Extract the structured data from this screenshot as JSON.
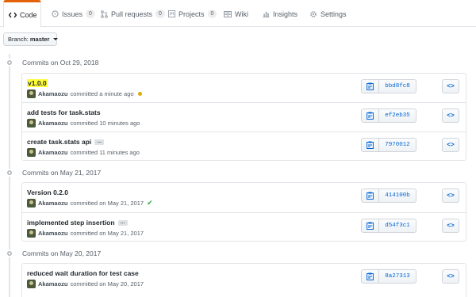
{
  "tabs": [
    {
      "label": "Code",
      "icon": "code-icon",
      "active": true
    },
    {
      "label": "Issues",
      "icon": "issue-icon",
      "count": "0"
    },
    {
      "label": "Pull requests",
      "icon": "pull-request-icon",
      "count": "0"
    },
    {
      "label": "Projects",
      "icon": "project-icon",
      "count": "0"
    },
    {
      "label": "Wiki",
      "icon": "book-icon"
    },
    {
      "label": "Insights",
      "icon": "graph-icon"
    },
    {
      "label": "Settings",
      "icon": "gear-icon"
    }
  ],
  "branch": {
    "prefix": "Branch:",
    "name": "master"
  },
  "groups": [
    {
      "heading": "Commits on Oct 29, 2018",
      "commits": [
        {
          "title": "v1.0.0",
          "highlight": true,
          "author": "Akamaozu",
          "time": "committed a minute ago",
          "status": "pending",
          "sha": "bbd8fc8"
        },
        {
          "title": "add tests for task.stats",
          "author": "Akamaozu",
          "time": "committed 10 minutes ago",
          "sha": "ef2eb35"
        },
        {
          "title": "create task.stats api",
          "expander": "…",
          "author": "Akamaozu",
          "time": "committed 11 minutes ago",
          "sha": "7970012"
        }
      ]
    },
    {
      "heading": "Commits on May 21, 2017",
      "commits": [
        {
          "title": "Version 0.2.0",
          "author": "Akamaozu",
          "time": "committed on May 21, 2017",
          "status": "success",
          "sha": "414100b"
        },
        {
          "title": "implemented step insertion",
          "expander": "…",
          "author": "Akamaozu",
          "time": "committed on May 21, 2017",
          "sha": "d54f3c1"
        }
      ]
    },
    {
      "heading": "Commits on May 20, 2017",
      "commits": [
        {
          "title": "reduced wait duration for test case",
          "author": "Akamaozu",
          "time": "committed on May 20, 2017",
          "sha": "8a27313"
        }
      ]
    }
  ],
  "browse_label": "<>",
  "colors": {
    "accent": "#e36209",
    "link": "#0366d6",
    "highlight": "#fffd38",
    "pending": "#dbab09",
    "success": "#28a745"
  }
}
